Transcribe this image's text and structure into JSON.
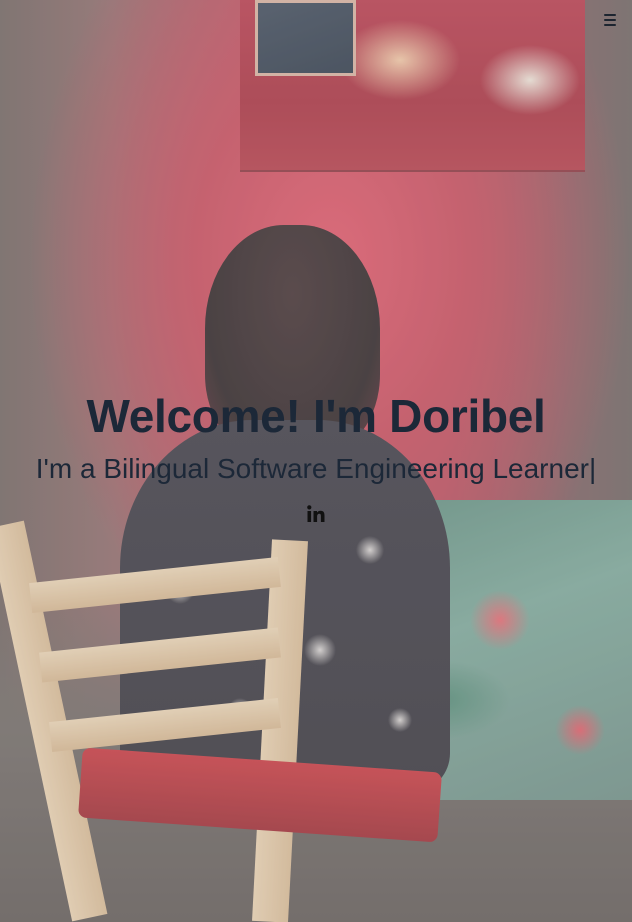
{
  "hero": {
    "title": "Welcome! I'm Doribel",
    "subtitle": "I'm a Bilingual Software Engineering Learner|",
    "background_image": "photo of a person with dark hair seated on a wooden chair facing a red wall with a painting and a floral tablecloth"
  },
  "nav": {
    "menu_icon": "hamburger-menu-icon"
  },
  "social": {
    "icons": [
      {
        "name": "linkedin-icon",
        "color": "#111111"
      }
    ]
  },
  "colors": {
    "text": "#1c2838",
    "accent_wall": "#c74b5c"
  }
}
